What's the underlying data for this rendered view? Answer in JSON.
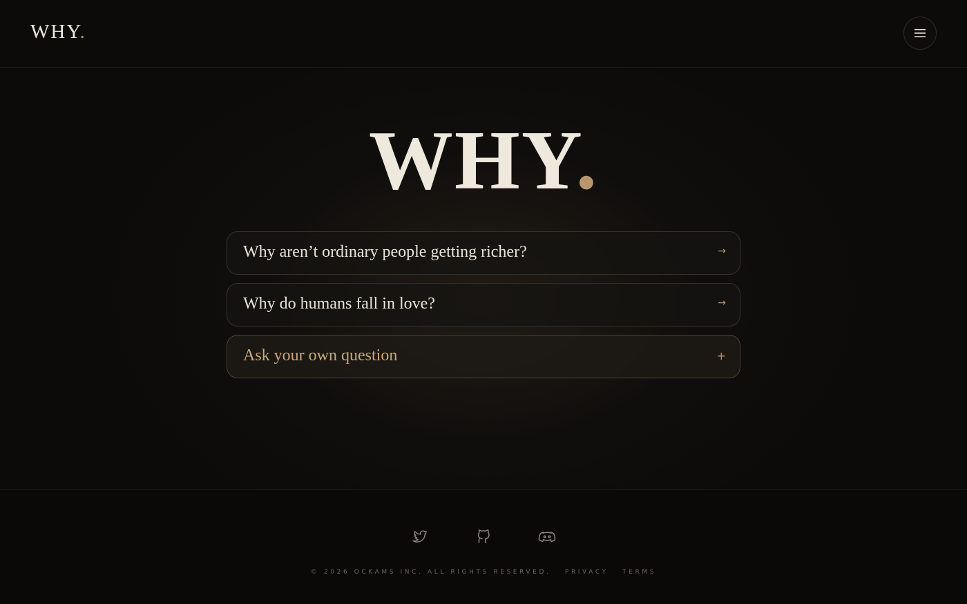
{
  "header": {
    "logo_text": "WHY",
    "logo_dot": ".",
    "menu_icon": "hamburger-menu-icon"
  },
  "hero": {
    "title": "WHY",
    "dot": "."
  },
  "questions": [
    {
      "text": "Why aren’t ordinary people getting richer?",
      "icon": "→"
    },
    {
      "text": "Why do humans fall in love?",
      "icon": "→"
    }
  ],
  "ask": {
    "text": "Ask your own question",
    "icon": "+"
  },
  "footer": {
    "socials": [
      "twitter-icon",
      "github-icon",
      "discord-icon"
    ],
    "copyright": "© 2026 OCKAMS INC. ALL RIGHTS RESERVED.",
    "privacy": "PRIVACY",
    "terms": "TERMS"
  },
  "colors": {
    "background": "#0c0b0a",
    "accent_gold": "#b8976a",
    "text_light": "#ece6da"
  }
}
